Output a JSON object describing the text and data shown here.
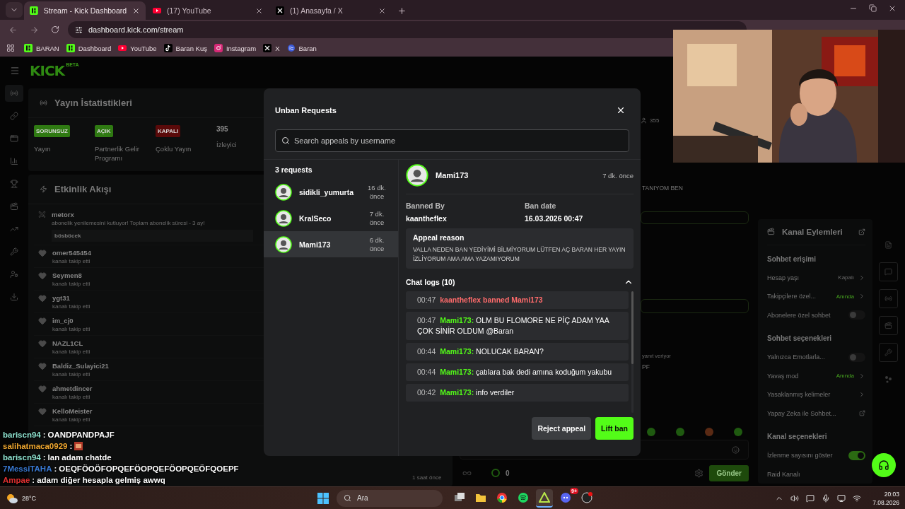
{
  "browser": {
    "tabs": [
      {
        "kind": "kick",
        "title": "Stream - Kick Dashboard",
        "selected": true
      },
      {
        "kind": "youtube",
        "title": "(17) YouTube",
        "selected": false
      },
      {
        "kind": "x",
        "title": "(1) Anasayfa / X",
        "selected": false
      }
    ],
    "url": "dashboard.kick.com/stream",
    "bookmarks": [
      {
        "kind": "kick",
        "label": "BARAN"
      },
      {
        "kind": "kick",
        "label": "Dashboard"
      },
      {
        "kind": "youtube",
        "label": "YouTube"
      },
      {
        "kind": "tiktok",
        "label": "Baran Kuş"
      },
      {
        "kind": "instagram",
        "label": "Instagram"
      },
      {
        "kind": "x",
        "label": "X"
      },
      {
        "kind": "swirl",
        "label": "Baran"
      }
    ]
  },
  "dashboard": {
    "logo": "KICK",
    "logo_badge": "BETA",
    "rail": [
      {
        "kind": "stream",
        "selected": true
      },
      {
        "kind": "link",
        "selected": false
      },
      {
        "kind": "window",
        "selected": false
      },
      {
        "kind": "chart",
        "selected": false
      },
      {
        "kind": "trophy",
        "selected": false
      },
      {
        "kind": "media",
        "selected": false
      },
      {
        "kind": "trend",
        "selected": false
      },
      {
        "kind": "tools",
        "selected": false
      },
      {
        "kind": "users",
        "selected": false
      },
      {
        "kind": "download",
        "selected": false
      }
    ],
    "stats": {
      "title": "Yayın İstatistikleri",
      "items": [
        {
          "kind": "badge",
          "badge": "SORUNSUZ",
          "color": "#2f7a12",
          "label": "Yayın"
        },
        {
          "kind": "badge",
          "badge": "AÇIK",
          "color": "#2f7a12",
          "label": "Partnerlik Gelir Programı"
        },
        {
          "kind": "badge",
          "badge": "KAPALI",
          "color": "#5a0a0a",
          "label": "Çoklu Yayın"
        },
        {
          "kind": "count",
          "value": "395",
          "label": "İzleyici"
        }
      ]
    },
    "activity": {
      "title": "Etkinlik Akışı",
      "items": [
        {
          "kind": "subscription",
          "user": "metorx",
          "text": "abonelik yenilemesini kutluyor! Toplam abonelik süresi - 3 ay!",
          "message": "bösböcek"
        },
        {
          "kind": "follow",
          "user": "omer545454",
          "text": "kanalı takip etti"
        },
        {
          "kind": "follow",
          "user": "Seymen8",
          "text": "kanalı takip etti"
        },
        {
          "kind": "follow",
          "user": "ygt31",
          "text": "kanalı takip etti"
        },
        {
          "kind": "follow",
          "user": "im_cj0",
          "text": "kanalı takip etti"
        },
        {
          "kind": "follow",
          "user": "NAZL1CL",
          "text": "kanalı takip etti"
        },
        {
          "kind": "follow",
          "user": "Baldiz_Sulayici21",
          "text": "kanalı takip etti"
        },
        {
          "kind": "follow",
          "user": "ahmetdincer",
          "text": "kanalı takip etti"
        },
        {
          "kind": "follow",
          "user": "KelloMeister",
          "text": "kanalı takip etti"
        }
      ],
      "time": "1 saat önce"
    },
    "chat": {
      "viewers": "355",
      "lines": [
        {
          "kind": "caps",
          "text": "TANIYOM BEN"
        },
        {
          "kind": "field"
        },
        {
          "kind": "field"
        },
        {
          "kind": "hint",
          "text": "yanıt veriyor"
        },
        {
          "kind": "caps",
          "text": "PF"
        }
      ],
      "points": "0",
      "send": "Gönder"
    },
    "channel_actions": {
      "title": "Kanal Eylemleri",
      "sections": [
        {
          "title": "Sohbet erişimi",
          "rows": [
            {
              "kind": "nav",
              "label": "Hesap yaşı",
              "value": "Kapalı",
              "on": false
            },
            {
              "kind": "nav",
              "label": "Takipçilere özel...",
              "value": "Anında",
              "on": true
            },
            {
              "kind": "toggle",
              "label": "Abonelere özel sohbet",
              "on": false
            }
          ]
        },
        {
          "title": "Sohbet seçenekleri",
          "rows": [
            {
              "kind": "toggle",
              "label": "Yalnızca Emotlarla...",
              "on": false
            },
            {
              "kind": "nav",
              "label": "Yavaş mod",
              "value": "Anında",
              "on": true
            },
            {
              "kind": "chevron",
              "label": "Yasaklanmış kelimeler"
            },
            {
              "kind": "link",
              "label": "Yapay Zeka ile Sohbet..."
            }
          ]
        },
        {
          "title": "Kanal seçenekleri",
          "rows": [
            {
              "kind": "toggle",
              "label": "İzlenme sayısını göster",
              "on": true
            },
            {
              "kind": "plain",
              "label": "Raid Kanalı"
            }
          ]
        }
      ]
    },
    "right_rail": [
      {
        "kind": "notes"
      },
      {
        "kind": "chat"
      },
      {
        "kind": "broadcast"
      },
      {
        "kind": "media"
      },
      {
        "kind": "tools"
      },
      {
        "kind": "more"
      }
    ]
  },
  "modal": {
    "title": "Unban Requests",
    "search_placeholder": "Search appeals by username",
    "count": "3 requests",
    "requests": [
      {
        "user": "sidikli_yumurta",
        "time": "16 dk. önce",
        "selected": false
      },
      {
        "user": "KralSeco",
        "time": "7 dk. önce",
        "selected": false
      },
      {
        "user": "Mami173",
        "time": "6 dk. önce",
        "selected": true
      }
    ],
    "detail": {
      "user": "Mami173",
      "time": "7 dk. önce",
      "banned_by_label": "Banned By",
      "banned_by": "kaantheflex",
      "ban_date_label": "Ban date",
      "ban_date": "16.03.2026 00:47",
      "reason_title": "Appeal reason",
      "reason": "VALLA NEDEN BAN YEDİYİMİ BİLMİYORUM LÜTFEN AÇ BARAN HER YAYIN İZLİYORUM AMA AMA YAZAMIYORUM",
      "logs_title": "Chat logs (10)",
      "logs_expanded": true,
      "logs": [
        {
          "kind": "ban",
          "time": "00:47",
          "text": "kaantheflex banned Mami173"
        },
        {
          "kind": "message",
          "time": "00:47",
          "user": "Mami173:",
          "text": "OLM BU FLOMORE NE PİÇ ADAM YAA ÇOK SİNİR OLDUM @Baran"
        },
        {
          "kind": "message",
          "time": "00:44",
          "user": "Mami173:",
          "text": "NOLUCAK BARAN?"
        },
        {
          "kind": "message",
          "time": "00:44",
          "user": "Mami173:",
          "text": "çatılara bak dedi amına koduğum yakubu"
        },
        {
          "kind": "message",
          "time": "00:42",
          "user": "Mami173:",
          "text": "info verdiler"
        }
      ]
    },
    "buttons": [
      {
        "kind": "secondary",
        "label": "Reject appeal"
      },
      {
        "kind": "primary",
        "label": "Lift ban"
      }
    ]
  },
  "stream_chat": [
    {
      "kind": "text",
      "user": "bariscn94",
      "sep": ":",
      "color": "#8fe3d0",
      "text": "OANDPANDPAJF"
    },
    {
      "kind": "emote",
      "user": "salihatmaca0929",
      "sep": ":",
      "color": "#f0a830"
    },
    {
      "kind": "text",
      "user": "bariscn94",
      "sep": ":",
      "color": "#8fe3d0",
      "text": "lan adam chatde"
    },
    {
      "kind": "text",
      "user": "7MessiTAHA",
      "sep": ":",
      "color": "#3a7bd5",
      "text": "OEQFÖOÖFOPQEFÖOPQEFÖOPQEÖFQOEPF"
    },
    {
      "kind": "text",
      "user": "Ampae",
      "sep": ":",
      "color": "#e03030",
      "text": "adam diğer hesapla gelmiş awwq"
    }
  ],
  "taskbar": {
    "weather": "28°C",
    "search": "Ara",
    "apps": [
      {
        "kind": "taskview",
        "active": false
      },
      {
        "kind": "files",
        "active": false
      },
      {
        "kind": "chrome",
        "active": false
      },
      {
        "kind": "spotify",
        "active": false
      },
      {
        "kind": "stream",
        "active": true
      },
      {
        "kind": "discord",
        "active": false,
        "badge": "9+"
      },
      {
        "kind": "obs",
        "active": false
      }
    ],
    "time": "20:03",
    "date": "7.08.2026"
  }
}
